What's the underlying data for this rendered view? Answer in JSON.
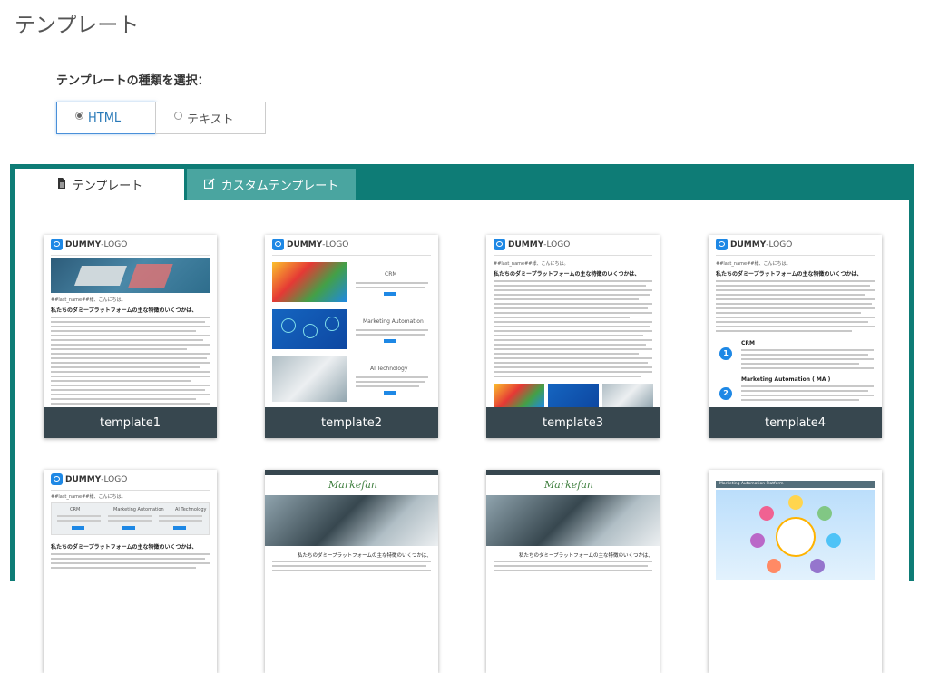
{
  "page": {
    "title": "テンプレート"
  },
  "template_type": {
    "label": "テンプレートの種類を選択：",
    "options": [
      {
        "label": "HTML",
        "selected": true
      },
      {
        "label": "テキスト",
        "selected": false
      }
    ]
  },
  "tabs": [
    {
      "label": "テンプレート",
      "icon": "document-icon",
      "active": true
    },
    {
      "label": "カスタムテンプレート",
      "icon": "edit-icon",
      "active": false
    }
  ],
  "templates": [
    {
      "name": "template1"
    },
    {
      "name": "template2"
    },
    {
      "name": "template3"
    },
    {
      "name": "template4"
    }
  ],
  "thumb_text": {
    "logo_bold": "DUMMY",
    "logo_light": "-LOGO",
    "greeting": "##last_name##様、こんにちは。",
    "heading": "私たちのダミープラットフォームの主な特徴のいくつかは、",
    "crm": "CRM",
    "ma": "Marketing Automation",
    "ma_full": "Marketing Automation ( MA )",
    "ai": "AI Technology",
    "brand": "Markefan",
    "platform": "Marketing Automation Platform",
    "num1": "1",
    "num2": "2"
  },
  "colors": {
    "accent_teal": "#0e7c76",
    "tab_inactive": "#4aa5a0",
    "card_bar": "#37474f",
    "selected_border": "#4a90d9"
  }
}
